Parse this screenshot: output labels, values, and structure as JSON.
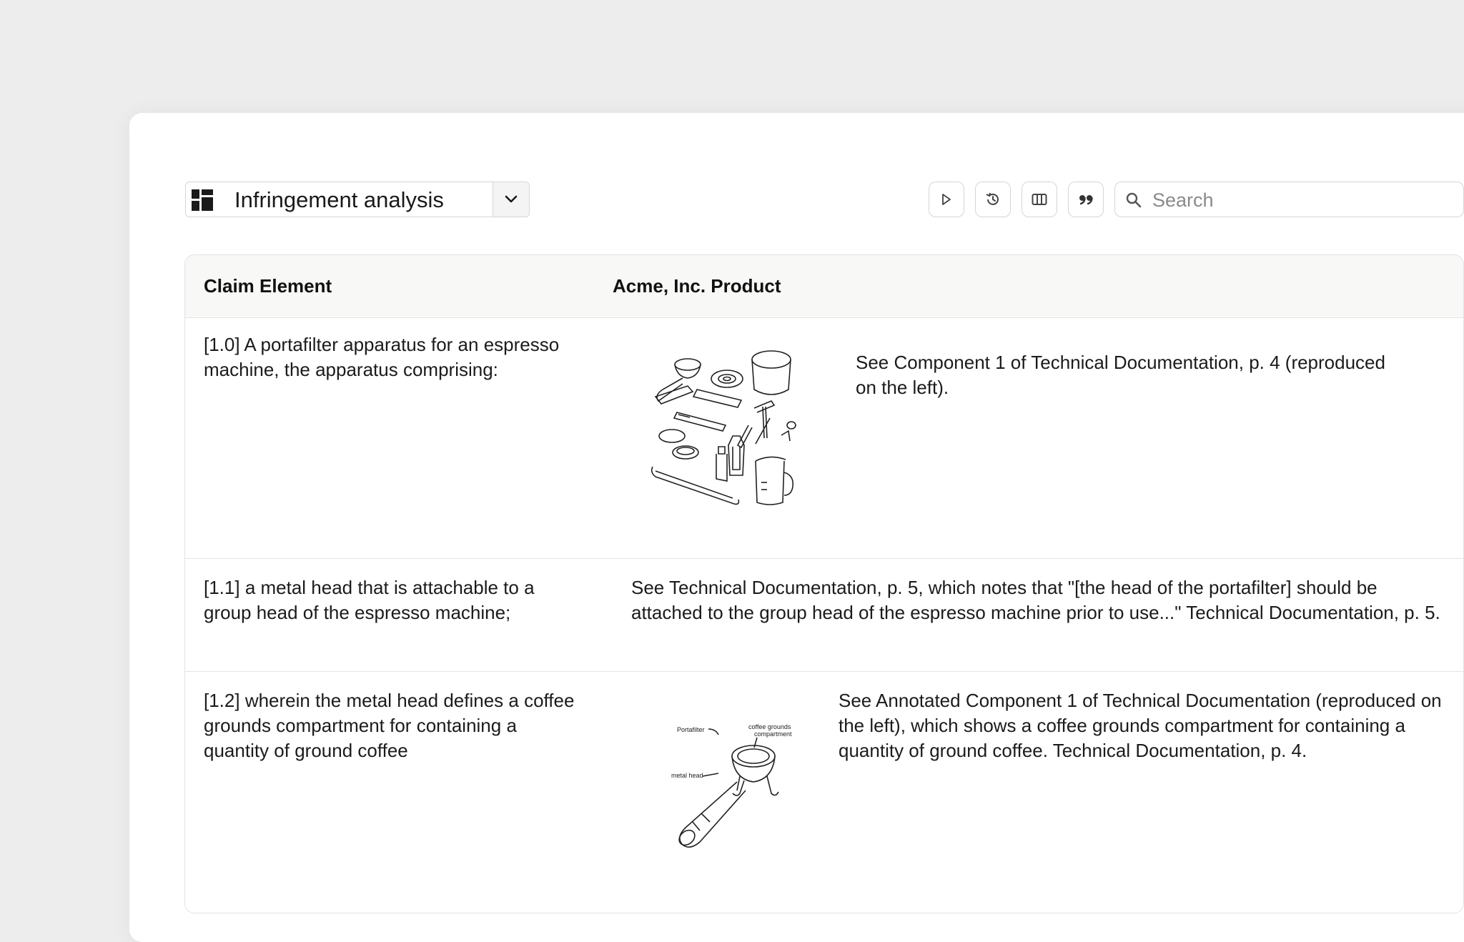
{
  "toolbar": {
    "view_title": "Infringement analysis",
    "view_icon": "grid-layout-icon",
    "buttons": [
      {
        "name": "run-button",
        "icon": "play-icon"
      },
      {
        "name": "history-button",
        "icon": "history-icon"
      },
      {
        "name": "columns-button",
        "icon": "columns-icon"
      },
      {
        "name": "quote-button",
        "icon": "quote-icon"
      }
    ],
    "search_placeholder": "Search"
  },
  "table": {
    "headers": [
      "Claim Element",
      "Acme, Inc. Product"
    ],
    "rows": [
      {
        "claim": "[1.0] A portafilter apparatus for an espresso machine, the apparatus comprising:",
        "evidence": "See Component 1 of Technical Documentation, p. 4 (reproduced on the left).",
        "figure": "exploded-parts-diagram"
      },
      {
        "claim": "[1.1] a metal head that is attachable to a group head of the espresso machine;",
        "evidence": "See Technical Documentation, p. 5, which notes that \"[the head of the portafilter] should be attached to the group head of the espresso machine prior to use...\" Technical Documentation, p. 5."
      },
      {
        "claim": "[1.2] wherein the metal head defines a coffee grounds compartment for containing a quantity of ground coffee",
        "evidence": "See Annotated Component 1 of Technical Documentation (reproduced on the left), which shows a coffee grounds compartment for containing a quantity of ground coffee. Technical Documentation, p. 4.",
        "figure": "annotated-portafilter-diagram",
        "figure_labels": {
          "portafilter": "Portafilter",
          "compartment_line1": "coffee grounds",
          "compartment_line2": "compartment",
          "metal_head": "metal head"
        }
      }
    ]
  },
  "colors": {
    "background": "#ededed",
    "card": "#ffffff",
    "header_bg": "#f8f8f7",
    "border": "#e2e2e2"
  }
}
